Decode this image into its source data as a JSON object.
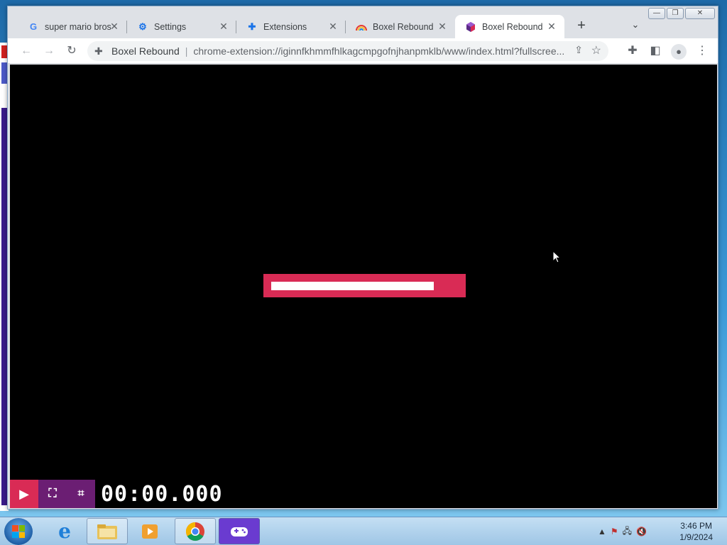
{
  "tabs": [
    {
      "title": "super mario bros",
      "icon": "google-g-icon"
    },
    {
      "title": "Settings",
      "icon": "gear-icon"
    },
    {
      "title": "Extensions",
      "icon": "puzzle-icon"
    },
    {
      "title": "Boxel Rebound",
      "icon": "rainbow-icon"
    },
    {
      "title": "Boxel Rebound",
      "icon": "boxel-cube-icon",
      "active": true
    }
  ],
  "omnibox": {
    "site_name": "Boxel Rebound",
    "url": "chrome-extension://iginnfkhmmfhlkagcmpgofnjhanpmklb/www/index.html?fullscree..."
  },
  "game": {
    "loading_progress": 0.87,
    "timer": "00:00.000",
    "accent_color": "#d92b55",
    "secondary_color": "#6b1e73"
  },
  "taskbar": {
    "apps": [
      "internet-explorer-icon",
      "file-explorer-icon",
      "media-player-icon",
      "chrome-icon",
      "boxel-game-icon"
    ]
  },
  "clock": {
    "time": "3:46 PM",
    "date": "1/9/2024"
  }
}
